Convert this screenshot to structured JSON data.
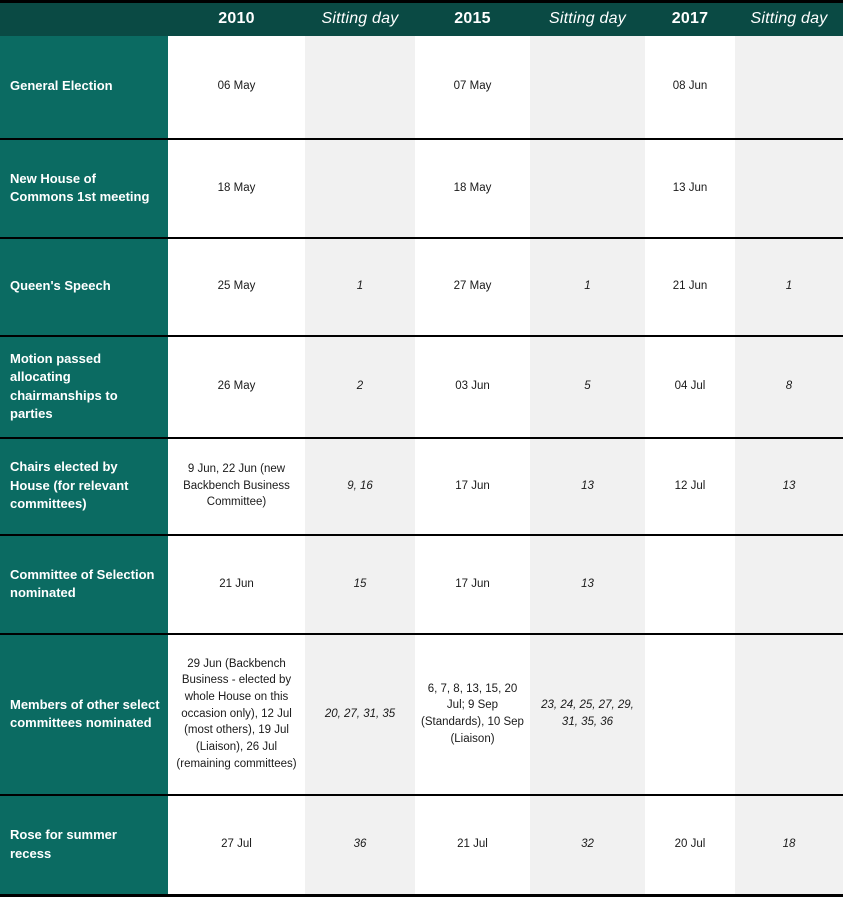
{
  "table": {
    "headers": [
      {
        "label": "",
        "style": "corner"
      },
      {
        "label": "2010",
        "style": "year"
      },
      {
        "label": "Sitting day",
        "style": "sitting"
      },
      {
        "label": "2015",
        "style": "year"
      },
      {
        "label": "Sitting day",
        "style": "sitting"
      },
      {
        "label": "2017",
        "style": "year"
      },
      {
        "label": "Sitting day",
        "style": "sitting"
      }
    ],
    "rows": [
      {
        "label": "General Election",
        "d2010": "06 May",
        "s2010": "",
        "d2015": "07 May",
        "s2015": "",
        "d2017": "08 Jun",
        "s2017": ""
      },
      {
        "label": "New House of Commons 1st meeting",
        "d2010": "18 May",
        "s2010": "",
        "d2015": "18 May",
        "s2015": "",
        "d2017": "13 Jun",
        "s2017": ""
      },
      {
        "label": "Queen's Speech",
        "d2010": "25 May",
        "s2010": "1",
        "d2015": "27 May",
        "s2015": "1",
        "d2017": "21 Jun",
        "s2017": "1"
      },
      {
        "label": "Motion passed allocating chairmanships to parties",
        "d2010": "26 May",
        "s2010": "2",
        "d2015": "03 Jun",
        "s2015": "5",
        "d2017": "04 Jul",
        "s2017": "8"
      },
      {
        "label": "Chairs elected by House (for relevant committees)",
        "d2010": "9 Jun, 22 Jun (new Backbench Business Committee)",
        "s2010": "9, 16",
        "d2015": "17 Jun",
        "s2015": "13",
        "d2017": "12 Jul",
        "s2017": "13"
      },
      {
        "label": "Committee of Selection nominated",
        "d2010": "21 Jun",
        "s2010": "15",
        "d2015": "17 Jun",
        "s2015": "13",
        "d2017": "",
        "s2017": ""
      },
      {
        "label": "Members of other select committees nominated",
        "d2010": "29 Jun (Backbench Business - elected by whole House on this occasion only), 12 Jul (most others), 19 Jul (Liaison), 26 Jul (remaining committees)",
        "s2010": "20, 27, 31, 35",
        "d2015": "6, 7, 8, 13, 15, 20 Jul; 9 Sep (Standards), 10 Sep (Liaison)",
        "s2015": "23, 24, 25, 27, 29, 31, 35, 36",
        "d2017": "",
        "s2017": ""
      },
      {
        "label": "Rose for summer recess",
        "d2010": "27 Jul",
        "s2010": "36",
        "d2015": "21 Jul",
        "s2015": "32",
        "d2017": "20 Jul",
        "s2017": "18"
      }
    ]
  },
  "colors": {
    "header_green": "#0a4a44",
    "label_green": "#0b6b62",
    "sitting_bg": "#f1f1f1",
    "date_bg": "#ffffff",
    "border": "#000000",
    "text": "#1a1a1a",
    "header_text": "#ffffff"
  }
}
